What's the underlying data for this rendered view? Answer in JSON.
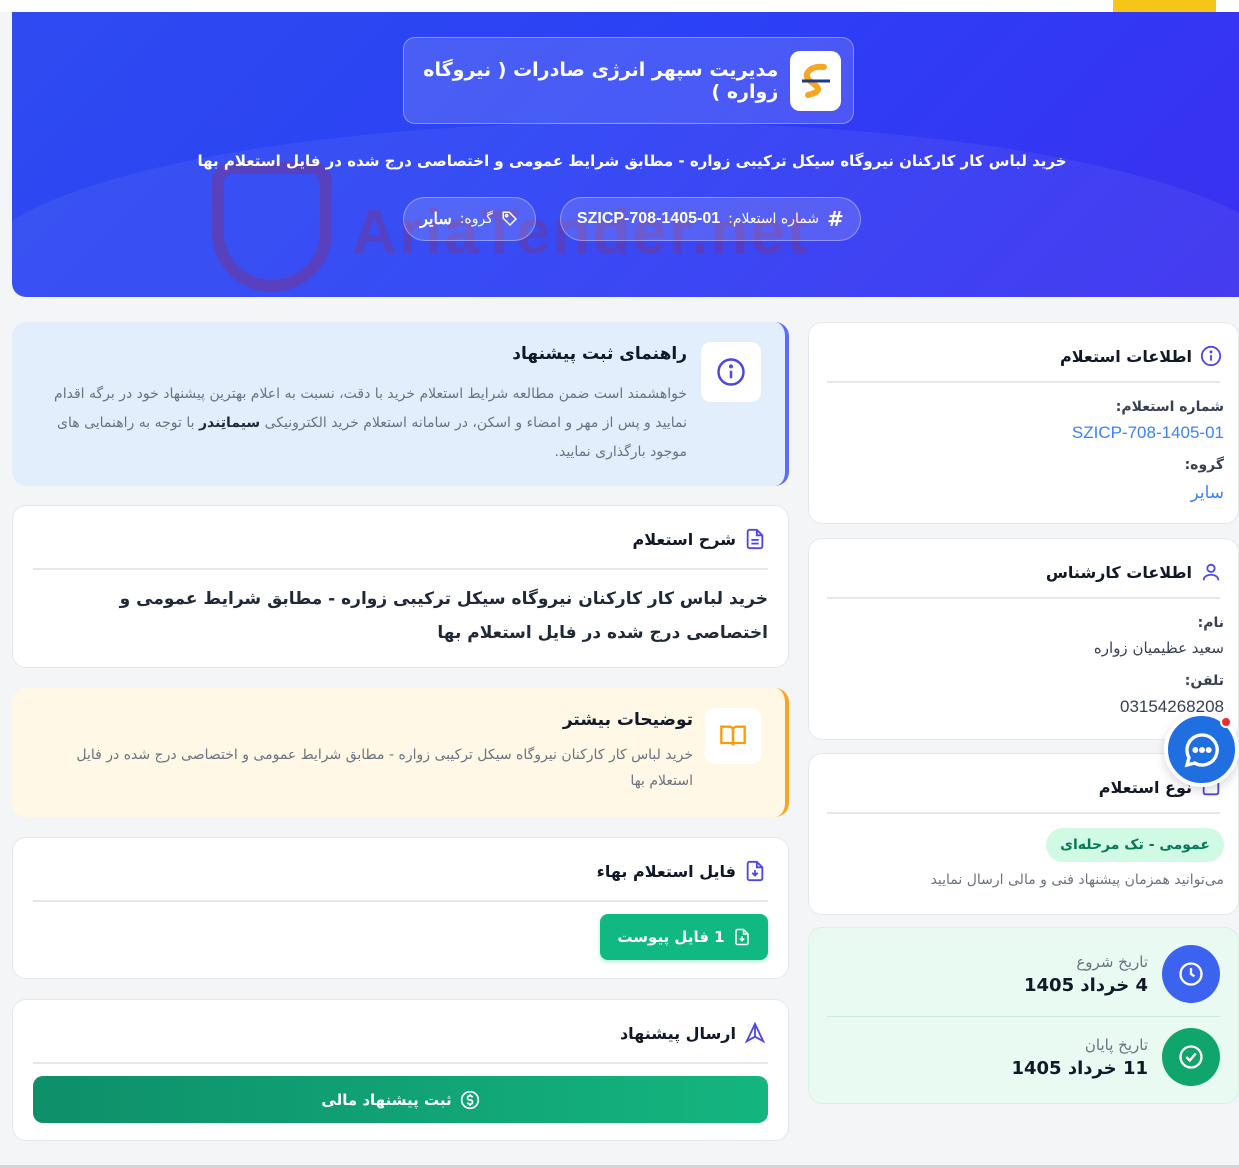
{
  "hero": {
    "company_name": "مدیریت سپهر انرژی صادرات ( نیروگاه زواره )",
    "title": "خرید لباس کار کارکنان نیروگاه سیکل ترکیبی زواره - مطابق شرایط عمومی و اختصاصی درج شده در فایل استعلام بها",
    "inquiry_label": "شماره استعلام:",
    "inquiry_number": "SZICP-708-1405-01",
    "group_label": "گروه:",
    "group_value": "سایر",
    "watermark": "AriaTender.net"
  },
  "guide": {
    "title": "راهنمای ثبت پیشنهاد",
    "text_before": "خواهشمند است ضمن مطالعه شرایط استعلام خرید با دقت، نسبت به اعلام بهترین پیشنهاد خود در برگه اقدام نمایید و پس از مهر و امضاء و اسکن، در سامانه استعلام خرید الکترونیکی ",
    "text_brand": "سیماتِندر",
    "text_after": " با توجه به راهنمایی های موجود بارگذاری نمایید."
  },
  "description": {
    "title": "شرح استعلام",
    "text": "خرید لباس کار کارکنان نیروگاه سیکل ترکیبی زواره - مطابق شرایط عمومی و اختصاصی درج شده در فایل استعلام بها"
  },
  "extra": {
    "title": "توضیحات بیشتر",
    "text": "خرید لباس کار کارکنان نیروگاه سیکل ترکیبی زواره - مطابق شرایط عمومی و اختصاصی درج شده در فایل استعلام بها"
  },
  "file": {
    "title": "فایل استعلام بهاء",
    "button": "1 فایل پیوست"
  },
  "submit": {
    "title": "ارسال پیشنهاد",
    "button": "ثبت پیشنهاد مالی"
  },
  "info": {
    "title": "اطلاعات استعلام",
    "number_label": "شماره استعلام:",
    "number_value": "SZICP-708-1405-01",
    "group_label": "گروه:",
    "group_value": "سایر"
  },
  "expert": {
    "title": "اطلاعات کارشناس",
    "name_label": "نام:",
    "name_value": "سعید عظیمیان زواره",
    "phone_label": "تلفن:",
    "phone_value": "03154268208"
  },
  "type": {
    "title": "نوع استعلام",
    "badge": "عمومی - تک مرحله‌ای",
    "note": "می‌توانید همزمان پیشنهاد فنی و مالی ارسال نمایید"
  },
  "dates": {
    "start_label": "تاریخ شروع",
    "start_value": "4 خرداد 1405",
    "end_label": "تاریخ پایان",
    "end_value": "11 خرداد 1405"
  },
  "colors": {
    "hero": "#2e4bf0",
    "accent_green": "#10b981",
    "accent_blue": "#3b82f6",
    "yellow": "#f5c518"
  }
}
